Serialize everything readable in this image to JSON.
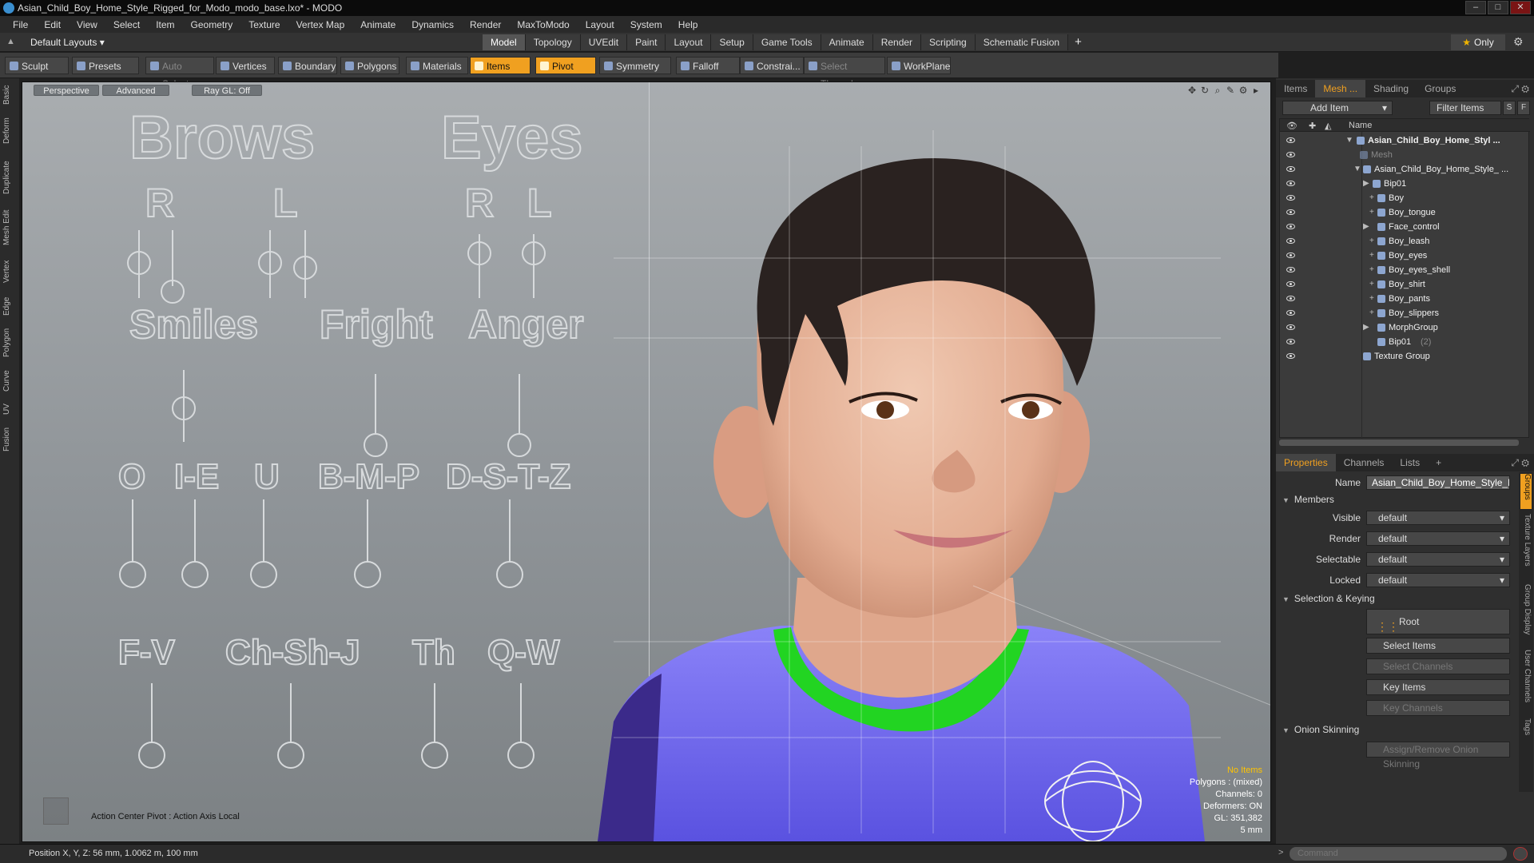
{
  "window": {
    "title": "Asian_Child_Boy_Home_Style_Rigged_for_Modo_modo_base.lxo* - MODO",
    "buttons": [
      "–",
      "□",
      "✕"
    ]
  },
  "menu": [
    "File",
    "Edit",
    "View",
    "Select",
    "Item",
    "Geometry",
    "Texture",
    "Vertex Map",
    "Animate",
    "Dynamics",
    "Render",
    "MaxToModo",
    "Layout",
    "System",
    "Help"
  ],
  "layout": {
    "selector": "Default Layouts ▾",
    "tabs": [
      "Model",
      "Topology",
      "UVEdit",
      "Paint",
      "Layout",
      "Setup",
      "Game Tools",
      "Animate",
      "Render",
      "Scripting",
      "Schematic Fusion"
    ],
    "active_tab": "Model",
    "only_label": "Only"
  },
  "toolbar": {
    "sculpt": "Sculpt",
    "presets": "Presets",
    "auto_select": "Auto Select",
    "vertices": "Vertices",
    "boundary": "Boundary",
    "polygons": "Polygons",
    "materials": "Materials",
    "items": "Items",
    "pivot": "Pivot",
    "symmetry": "Symmetry",
    "falloff": "Falloff",
    "constrain": "Constrai...",
    "select_through": "Select Through",
    "workplane": "WorkPlane"
  },
  "left_tabs": [
    "Basic",
    "Deform",
    "Duplicate",
    "Mesh Edit",
    "Vertex",
    "Edge",
    "Polygon",
    "Curve",
    "UV",
    "Fusion"
  ],
  "viewport": {
    "view_mode": "Perspective",
    "advanced": "Advanced",
    "raygl": "Ray GL: Off",
    "action_center": "Action Center Pivot : Action Axis Local",
    "status": {
      "no_items": "No Items",
      "polygons": "Polygons : (mixed)",
      "channels": "Channels: 0",
      "deformers": "Deformers: ON",
      "gl": "GL: 351,382",
      "scale": "5 mm"
    },
    "face_panel": {
      "brows": "Brows",
      "eyes": "Eyes",
      "r": "R",
      "l": "L",
      "smiles": "Smiles",
      "fright": "Fright",
      "anger": "Anger",
      "visemes_row1": [
        "O",
        "I-E",
        "U",
        "B-M-P",
        "D-S-T-Z"
      ],
      "visemes_row2": [
        "F-V",
        "Ch-Sh-J",
        "Th",
        "Q-W"
      ]
    }
  },
  "items_panel": {
    "tabs": [
      "Items",
      "Mesh ...",
      "Shading",
      "Groups"
    ],
    "active_tab": "Mesh ...",
    "add_item": "Add Item",
    "filter_items": "Filter Items",
    "btn_s": "S",
    "btn_f": "F",
    "col_name": "Name",
    "rows": [
      {
        "label": "Asian_Child_Boy_Home_Styl ...",
        "eye": true
      },
      {
        "label": "Mesh",
        "eye": true
      },
      {
        "label": "Asian_Child_Boy_Home_Style_ ...",
        "eye": true
      },
      {
        "label": "Bip01",
        "eye": true
      },
      {
        "label": "Boy",
        "eye": true
      },
      {
        "label": "Boy_tongue",
        "eye": true
      },
      {
        "label": "Face_control",
        "eye": true
      },
      {
        "label": "Boy_leash",
        "eye": true
      },
      {
        "label": "Boy_eyes",
        "eye": true
      },
      {
        "label": "Boy_eyes_shell",
        "eye": true
      },
      {
        "label": "Boy_shirt",
        "eye": true
      },
      {
        "label": "Boy_pants",
        "eye": true
      },
      {
        "label": "Boy_slippers",
        "eye": true
      },
      {
        "label": "MorphGroup",
        "eye": true
      },
      {
        "label": "Bip01",
        "suffix": "(2)",
        "eye": true
      },
      {
        "label": "Texture Group",
        "eye": true
      }
    ]
  },
  "properties": {
    "tabs": [
      "Properties",
      "Channels",
      "Lists"
    ],
    "active_tab": "Properties",
    "name_label": "Name",
    "name_value": "Asian_Child_Boy_Home_Style_Rigg",
    "members": "Members",
    "visible_label": "Visible",
    "render_label": "Render",
    "selectable_label": "Selectable",
    "locked_label": "Locked",
    "default_value": "default",
    "selection_keying": "Selection & Keying",
    "root": "Root",
    "select_items": "Select Items",
    "select_channels": "Select Channels",
    "key_items": "Key Items",
    "key_channels": "Key Channels",
    "onion_skinning": "Onion Skinning",
    "assign_remove": "Assign/Remove Onion Skinning",
    "side_tabs": [
      "Groups",
      "Texture Layers",
      "Group Display",
      "User Channels",
      "Tags"
    ]
  },
  "statusbar": {
    "position": "Position X, Y, Z:  56 mm, 1.0062 m, 100 mm",
    "command_placeholder": "Command"
  },
  "colors": {
    "accent": "#f0a020",
    "shirt": "#6b63f0",
    "collar": "#22d422"
  }
}
